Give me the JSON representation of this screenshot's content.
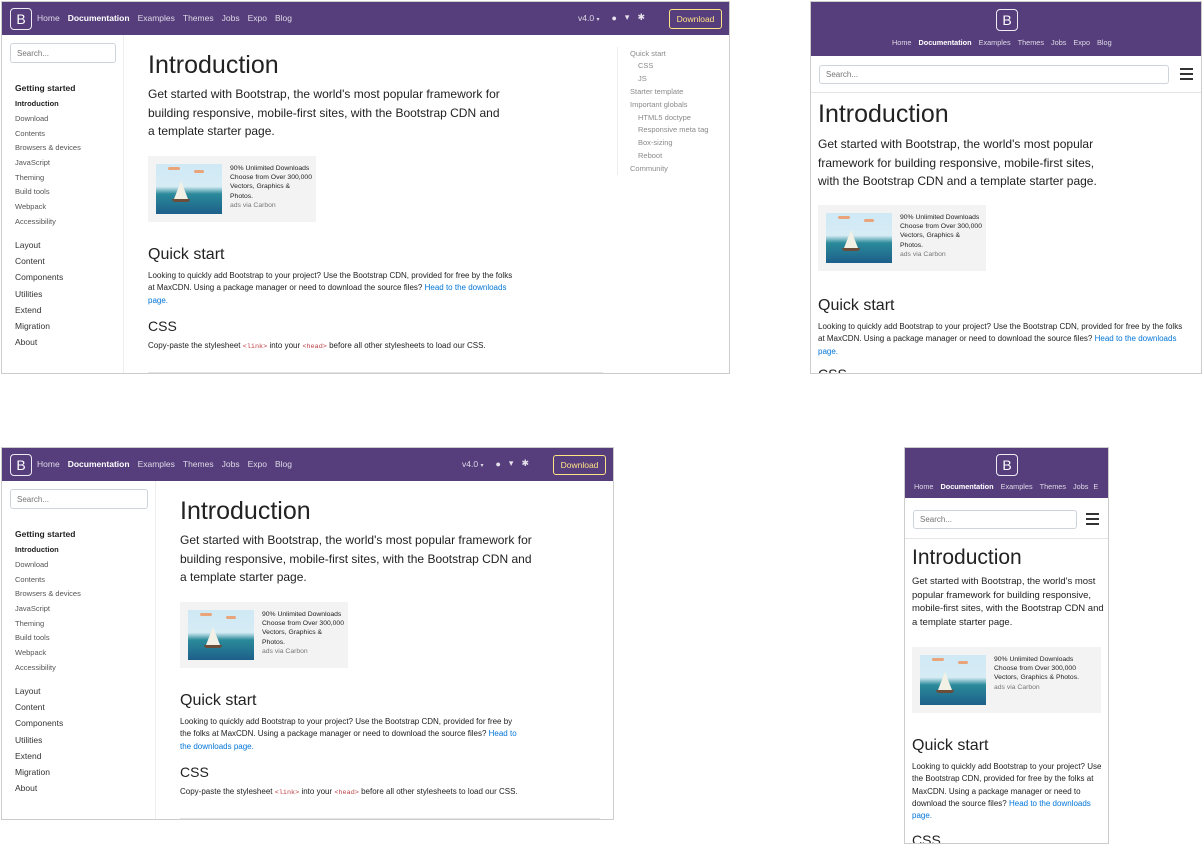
{
  "brand_letter": "B",
  "colors": {
    "nav_bg": "#563d7c",
    "download_accent": "#ffe484",
    "link": "#0275d8",
    "code": "#bd4147"
  },
  "nav": {
    "links": [
      "Home",
      "Documentation",
      "Examples",
      "Themes",
      "Jobs",
      "Expo",
      "Blog"
    ],
    "links_narrow": [
      "Home",
      "Documentation",
      "Examples",
      "Themes",
      "Jobs",
      "E"
    ],
    "version": "v4.0",
    "download": "Download",
    "icons": [
      "github-icon",
      "twitter-icon",
      "slack-icon"
    ]
  },
  "search": {
    "placeholder": "Search..."
  },
  "sidebar": {
    "group_title": "Getting started",
    "active": "Introduction",
    "items": [
      "Download",
      "Contents",
      "Browsers & devices",
      "JavaScript",
      "Theming",
      "Build tools",
      "Webpack",
      "Accessibility"
    ],
    "top": [
      "Layout",
      "Content",
      "Components",
      "Utilities",
      "Extend",
      "Migration",
      "About"
    ]
  },
  "page": {
    "title": "Introduction",
    "lead": "Get started with Bootstrap, the world's most popular framework for building responsive, mobile-first sites, with the Bootstrap CDN and a template starter page.",
    "ad_text": "90% Unlimited Downloads Choose from Over 300,000 Vectors, Graphics & Photos.",
    "ad_via": "ads via Carbon",
    "quick_start_title": "Quick start",
    "quick_start_text": "Looking to quickly add Bootstrap to your project? Use the Bootstrap CDN, provided for free by the folks at MaxCDN. Using a package manager or need to download the source files?",
    "quick_start_link": "Head to the downloads page.",
    "css_title": "CSS",
    "css_text_1": "Copy-paste the stylesheet",
    "css_code_1": "<link>",
    "css_text_2": "into your",
    "css_code_2": "<head>",
    "css_text_3": "before all other stylesheets to load our CSS.",
    "css_partial": "CSS"
  },
  "toc": [
    {
      "label": "Quick start",
      "level": 1
    },
    {
      "label": "CSS",
      "level": 2
    },
    {
      "label": "JS",
      "level": 2
    },
    {
      "label": "Starter template",
      "level": 1
    },
    {
      "label": "Important globals",
      "level": 1
    },
    {
      "label": "HTML5 doctype",
      "level": 2
    },
    {
      "label": "Responsive meta tag",
      "level": 2
    },
    {
      "label": "Box-sizing",
      "level": 2
    },
    {
      "label": "Reboot",
      "level": 2
    },
    {
      "label": "Community",
      "level": 1
    }
  ]
}
